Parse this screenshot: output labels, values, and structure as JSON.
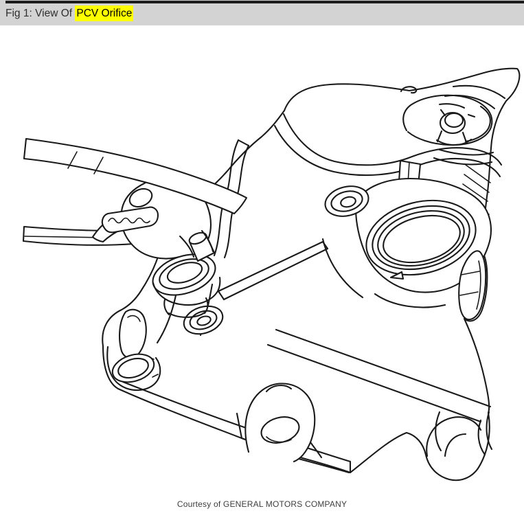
{
  "header": {
    "title_prefix": "Fig 1: View Of ",
    "highlight": "PCV Orifice",
    "bg_color": "#d3d3d3",
    "highlight_color": "#ffff00",
    "text_color": "#2f2f2f"
  },
  "figure": {
    "alt": "Black-and-white technical line drawing of slip-joint pliers gripping and removing the PCV orifice grommet from an engine camshaft (valve) cover",
    "line_color": "#1a1a1a",
    "background_color": "#ffffff"
  },
  "caption": {
    "text": "Courtesy of GENERAL MOTORS COMPANY"
  }
}
